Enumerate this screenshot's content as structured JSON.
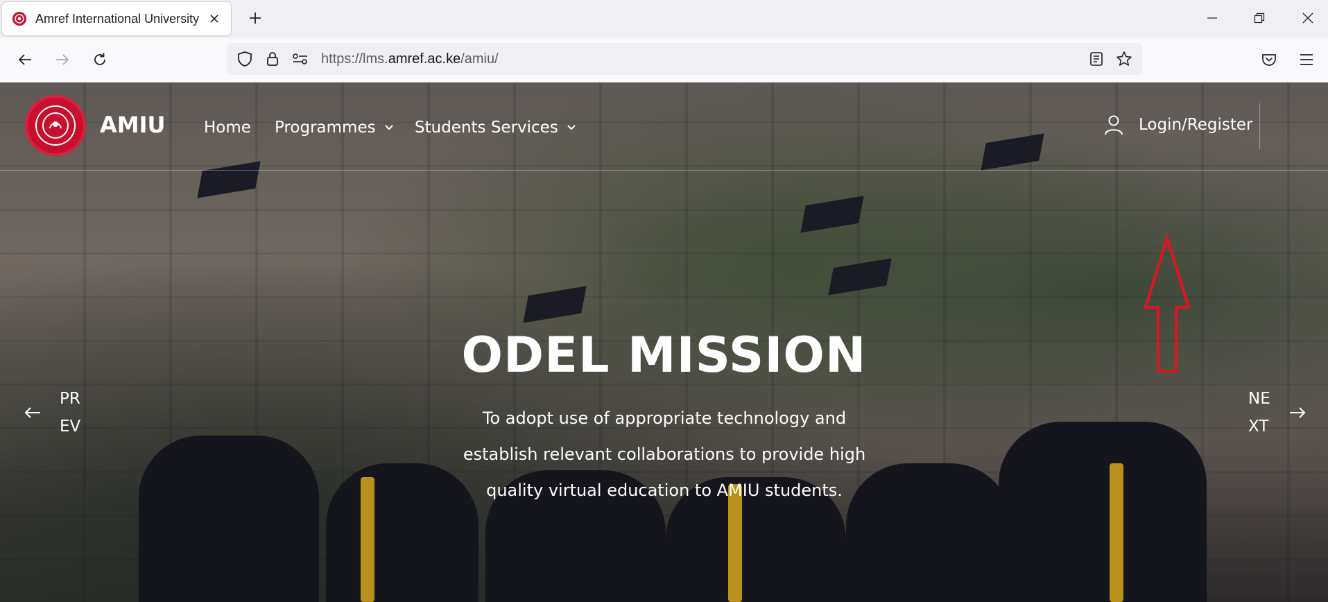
{
  "browser": {
    "tab": {
      "title": "Amref International University"
    },
    "address": {
      "prefix": "https://lms.",
      "host": "amref.ac.ke",
      "path": "/amiu/"
    }
  },
  "site": {
    "brand": "AMIU",
    "nav": [
      {
        "label": "Home"
      },
      {
        "label": "Programmes"
      },
      {
        "label": "Students Services"
      }
    ],
    "login_label": "Login/Register"
  },
  "hero": {
    "title": "ODEL MISSION",
    "text": "To adopt use of appropriate technology and establish relevant collaborations to provide high quality virtual education to AMIU students.",
    "prev": {
      "line1": "PR",
      "line2": "EV"
    },
    "next": {
      "line1": "NE",
      "line2": "XT"
    }
  },
  "colors": {
    "brand_red": "#c8102e",
    "annotation_red": "#e0141e"
  },
  "icons": [
    "shield-icon",
    "lock-icon",
    "site-settings-icon",
    "reader-view-icon",
    "bookmark-star-icon",
    "pocket-icon",
    "hamburger-menu-icon",
    "user-icon",
    "arrow-left-icon",
    "arrow-right-icon"
  ]
}
